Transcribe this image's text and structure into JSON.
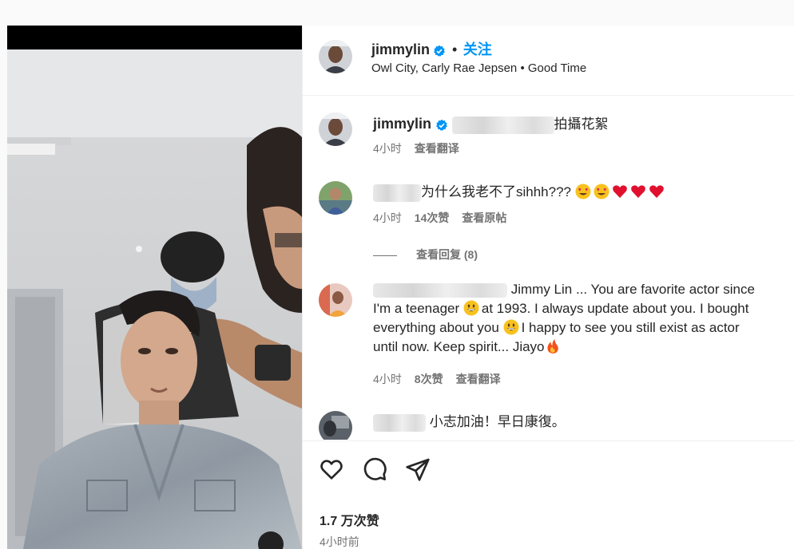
{
  "header": {
    "username": "jimmylin",
    "separator": "•",
    "follow_label": "关注",
    "music": "Owl City, Carly Rae Jepsen • Good Time"
  },
  "caption": {
    "username": "jimmylin",
    "text_after_blur": "拍攝花絮",
    "time": "4小时",
    "translate": "查看翻译"
  },
  "comments": [
    {
      "text": "为什么我老不了sihhh???",
      "emojis": [
        "heart-eyes-emoji",
        "heart-eyes-emoji",
        "red-heart-emoji",
        "red-heart-emoji",
        "red-heart-emoji"
      ],
      "time": "4小时",
      "likes": "14次赞",
      "action": "查看原帖",
      "replies": "查看回复 (8)"
    },
    {
      "line1": "Jimmy Lin ... You are favorite actor since",
      "line2a": "I'm a teenager",
      "line2b": "at 1993. I always update about you. I bought",
      "line3a": "everything about you",
      "line3b": "I happy to see you still exist as actor",
      "line4": "until now. Keep spirit... Jiayo",
      "time": "4小时",
      "likes": "8次赞",
      "action": "查看翻译"
    },
    {
      "text": "小志加油！早日康復。"
    }
  ],
  "footer": {
    "likes": "1.7 万次赞",
    "time": "4小时前"
  },
  "colors": {
    "accent": "#0095f6",
    "secondary_text": "#737373",
    "heart": "#e0245e"
  },
  "icons": [
    "verified-badge-icon",
    "heart-outline-icon",
    "comment-icon",
    "share-icon"
  ]
}
